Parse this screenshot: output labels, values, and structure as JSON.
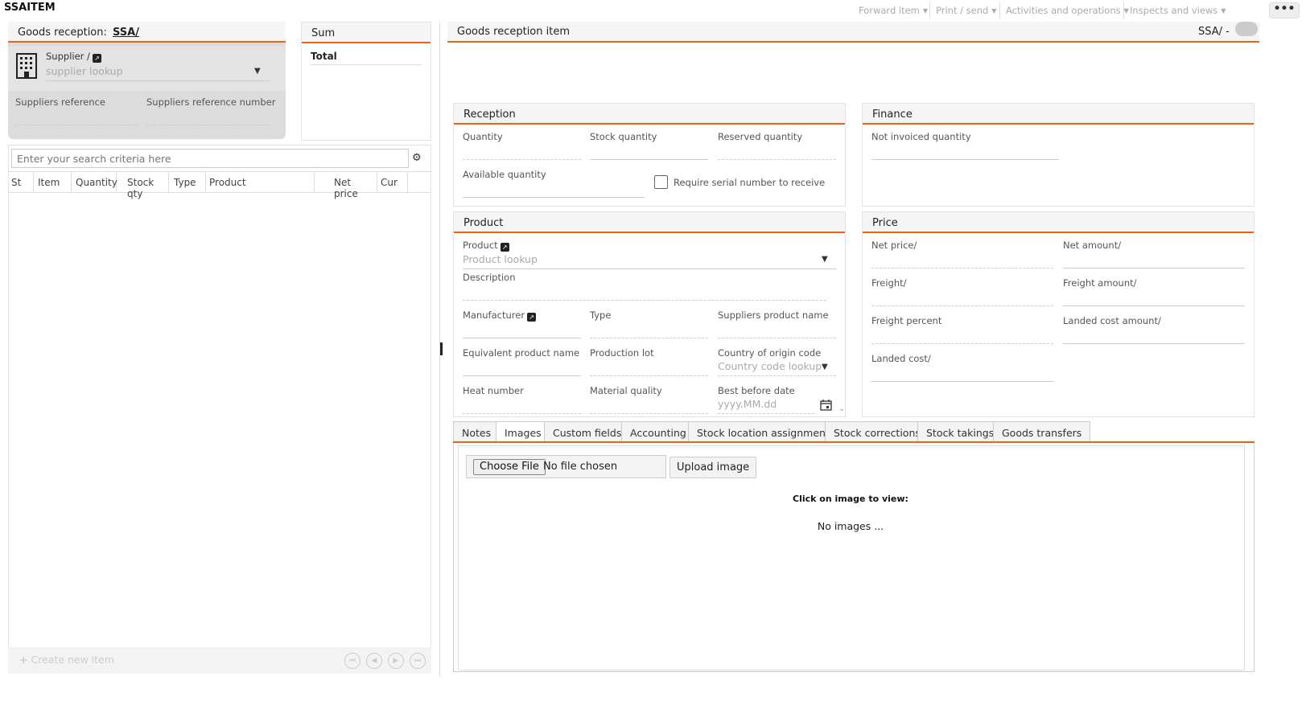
{
  "app": {
    "title": "SSAITEM"
  },
  "topmenu": {
    "forward": "Forward item",
    "print": "Print / send",
    "activities": "Activities and operations",
    "inspects": "Inspects and views",
    "more": "•••"
  },
  "left": {
    "header_prefix": "Goods reception:",
    "header_link": "SSA/",
    "supplier_label": "Supplier /",
    "supplier_placeholder": "supplier lookup",
    "suppliers_reference": "Suppliers reference",
    "suppliers_reference_number": "Suppliers reference number",
    "search_placeholder": "Enter your search criteria here",
    "columns": [
      "St",
      "Item",
      "Quantity",
      "Stock qty",
      "Type",
      "Product",
      "Net price",
      "Cur"
    ],
    "create_new": "Create new item"
  },
  "sum": {
    "title": "Sum",
    "total": "Total"
  },
  "right": {
    "header": "Goods reception item",
    "header_right": "SSA/ -",
    "reception": {
      "title": "Reception",
      "quantity": "Quantity",
      "stock_quantity": "Stock quantity",
      "reserved_quantity": "Reserved quantity",
      "available_quantity": "Available quantity",
      "require_serial": "Require serial number to receive"
    },
    "finance": {
      "title": "Finance",
      "not_invoiced": "Not invoiced quantity"
    },
    "product": {
      "title": "Product",
      "product_label": "Product",
      "product_placeholder": "Product lookup",
      "description": "Description",
      "manufacturer": "Manufacturer",
      "type": "Type",
      "suppliers_product_name": "Suppliers product name",
      "equivalent_product_name": "Equivalent product name",
      "production_lot": "Production lot",
      "country_of_origin": "Country of origin code",
      "country_placeholder": "Country code lookup",
      "heat_number": "Heat number",
      "material_quality": "Material quality",
      "best_before_date": "Best before date",
      "date_placeholder": "yyyy.MM.dd"
    },
    "price": {
      "title": "Price",
      "net_price": "Net price/",
      "net_amount": "Net amount/",
      "freight": "Freight/",
      "freight_amount": "Freight amount/",
      "freight_percent": "Freight percent",
      "landed_cost_amount": "Landed cost amount/",
      "landed_cost": "Landed cost/"
    },
    "tabs": [
      "Notes",
      "Images",
      "Custom fields",
      "Accounting",
      "Stock location assignments",
      "Stock corrections",
      "Stock takings",
      "Goods transfers"
    ],
    "images": {
      "choose_file": "Choose File",
      "no_file": "No file chosen",
      "upload": "Upload image",
      "click_to_view": "Click on image to view:",
      "no_images": "No images ..."
    }
  },
  "colors": {
    "accent": "#e8641c"
  }
}
